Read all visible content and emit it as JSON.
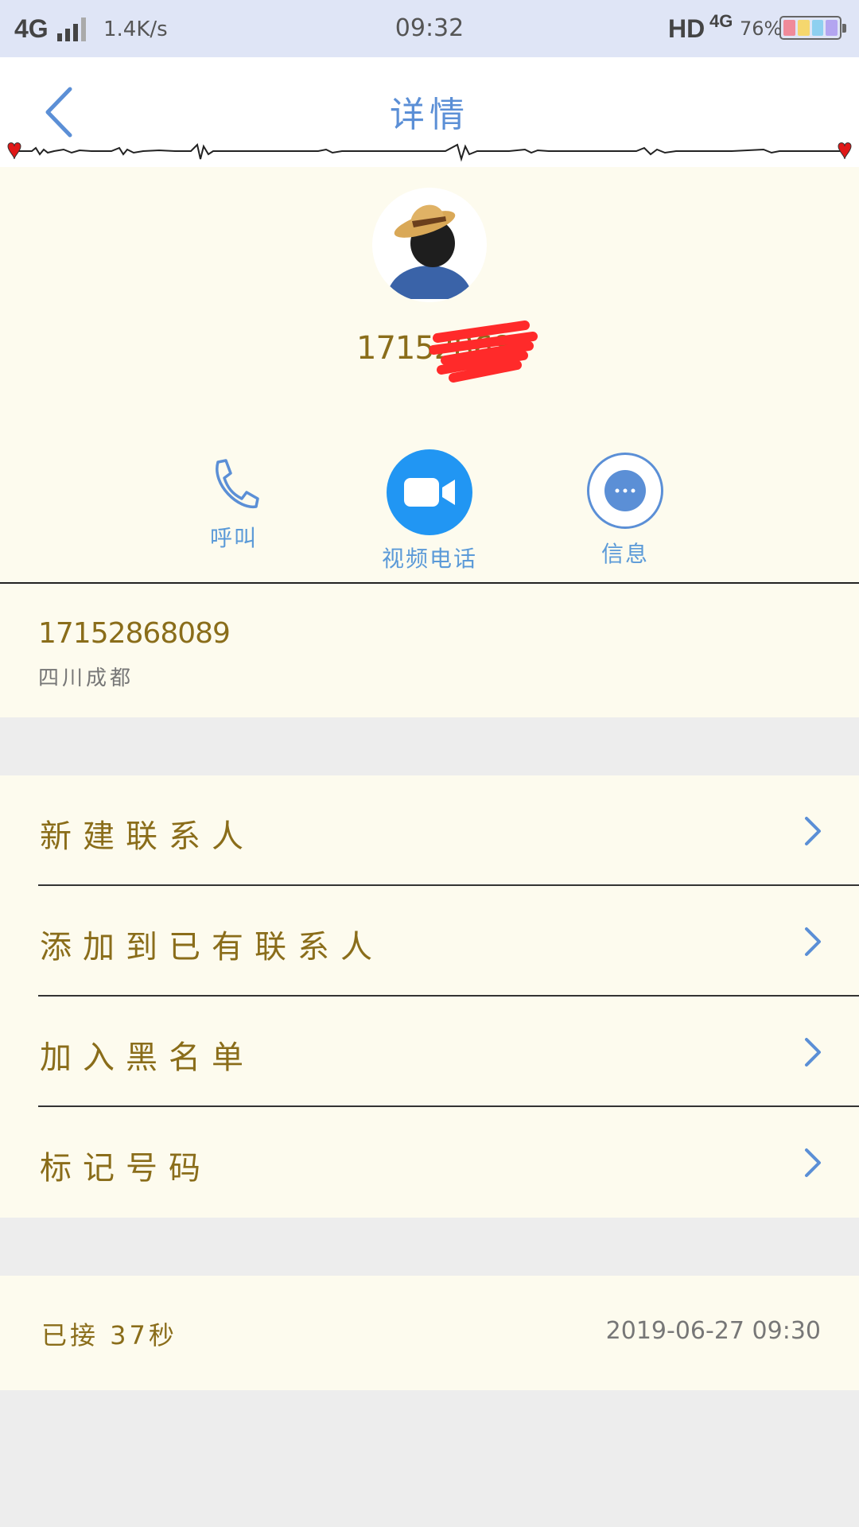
{
  "status_bar": {
    "network": "4G",
    "speed": "1.4K/s",
    "time": "09:32",
    "hd": "HD",
    "network2": "4G",
    "battery": "76%"
  },
  "header": {
    "title": "详情"
  },
  "profile": {
    "phone_partial": "17152868"
  },
  "actions": {
    "call": "呼叫",
    "video": "视频电话",
    "message": "信息"
  },
  "number_card": {
    "number": "17152868089",
    "location": "四川成都"
  },
  "menu": {
    "items": [
      {
        "label": "新建联系人"
      },
      {
        "label": "添加到已有联系人"
      },
      {
        "label": "加入黑名单"
      },
      {
        "label": "标记号码"
      }
    ]
  },
  "call_record": {
    "status": "已接 37秒",
    "datetime": "2019-06-27 09:30"
  },
  "colors": {
    "accent_blue": "#5b8fd6",
    "video_blue": "#2196f3",
    "gold_text": "#8a6d1a",
    "card_bg": "#fdfbee",
    "heart_red": "#e01818"
  }
}
